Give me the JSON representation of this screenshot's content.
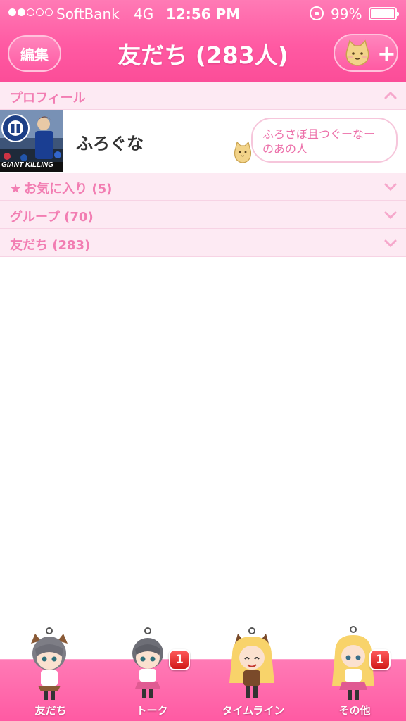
{
  "status_bar": {
    "carrier": "SoftBank",
    "network": "4G",
    "time": "12:56 PM",
    "battery": "99%"
  },
  "nav": {
    "edit_label": "編集",
    "title": "友だち (283人)"
  },
  "sections": {
    "profile_label": "プロフィール",
    "favorites_label": "お気に入り (5)",
    "groups_label": "グループ (70)",
    "friends_label": "友だち (283)"
  },
  "profile": {
    "name": "ふろぐな",
    "status_message_line1": "ふろさぼ且つぐーなー",
    "status_message_line2": "のあの人",
    "avatar_caption": "GIANT KILLING"
  },
  "tabs": [
    {
      "label": "友だち",
      "badge": ""
    },
    {
      "label": "トーク",
      "badge": "1"
    },
    {
      "label": "タイムライン",
      "badge": ""
    },
    {
      "label": "その他",
      "badge": "1"
    }
  ],
  "colors": {
    "header_pink": "#ff5aa3",
    "section_bg": "#fdeaf3",
    "section_text": "#f27db2",
    "badge_red": "#d01818"
  }
}
